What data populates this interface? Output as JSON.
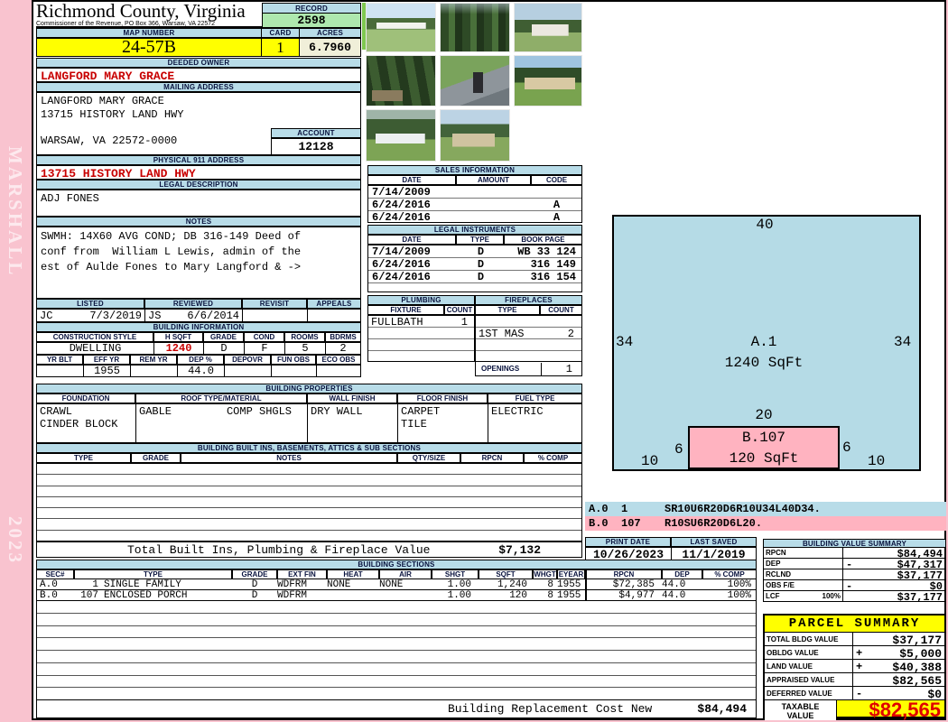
{
  "sidebar": {
    "vendor": "MARSHALL",
    "year": "2023"
  },
  "header": {
    "county": "Richmond County, Virginia",
    "commissioner": "Commissioner of the Revenue, PO Box 366, Warsaw, VA 22572",
    "record_label": "RECORD",
    "record_value": "2598",
    "map_label": "MAP NUMBER",
    "map_value": "24-57B",
    "card_label": "CARD",
    "card_value": "1",
    "acres_label": "ACRES",
    "acres_value": "6.7960"
  },
  "owner": {
    "deeded_label": "DEEDED OWNER",
    "deeded_value": "LANGFORD MARY GRACE",
    "mailing_label": "MAILING ADDRESS",
    "mail1": "LANGFORD MARY GRACE",
    "mail2": "13715 HISTORY LAND HWY",
    "mail3": "",
    "mail4": "WARSAW, VA 22572-0000",
    "account_label": "ACCOUNT",
    "account_value": "12128",
    "physical_label": "PHYSICAL 911 ADDRESS",
    "physical_value": "13715 HISTORY LAND HWY",
    "legal_label": "LEGAL DESCRIPTION",
    "legal_value": "ADJ FONES",
    "notes_label": "NOTES",
    "note1": "SWMH: 14X60 AVG COND; DB 316-149 Deed of",
    "note2": "conf from  William L Lewis, admin of the",
    "note3": "est of Aulde Fones to Mary Langford & ->"
  },
  "review": {
    "h": [
      "LISTED",
      "REVIEWED",
      "REVISIT",
      "APPEALS"
    ],
    "listed_by": "JC",
    "listed_date": "7/3/2019",
    "reviewed_by": "JS",
    "reviewed_date": "6/6/2014",
    "revisit": "",
    "appeals": ""
  },
  "building_info": {
    "banner": "BUILDING INFORMATION",
    "h1": [
      "CONSTRUCTION STYLE",
      "H SQFT",
      "GRADE",
      "COND",
      "ROOMS",
      "BDRMS"
    ],
    "style": "DWELLING",
    "hsqft": "1240",
    "grade": "D",
    "cond": "F",
    "rooms": "5",
    "bdrms": "2",
    "h2": [
      "YR BLT",
      "EFF YR",
      "REM YR",
      "DEP %",
      "DEPOVR",
      "FUN OBS",
      "ECO OBS"
    ],
    "yrblt": "",
    "effyr": "1955",
    "remyr": "",
    "dep": "44.0",
    "depovr": "",
    "funobs": "",
    "ecoobs": ""
  },
  "props": {
    "banner": "BUILDING PROPERTIES",
    "h": [
      "FOUNDATION",
      "ROOF TYPE/MATERIAL",
      "WALL FINISH",
      "FLOOR FINISH",
      "FUEL TYPE"
    ],
    "foundation1": "CRAWL",
    "foundation2": "CINDER BLOCK",
    "roof1": "GABLE",
    "roof2": "COMP SHGLS",
    "wall": "DRY WALL",
    "floor1": "CARPET",
    "floor2": "TILE",
    "fuel": "ELECTRIC"
  },
  "built_ins": {
    "banner": "BUILDING BUILT INS, BASEMENTS, ATTICS & SUB SECTIONS",
    "h": [
      "TYPE",
      "GRADE",
      "NOTES",
      "QTY/SIZE",
      "RPCN",
      "% COMP"
    ],
    "total_label": "Total Built Ins, Plumbing & Fireplace Value",
    "total_value": "$7,132"
  },
  "sales": {
    "banner": "SALES INFORMATION",
    "h": [
      "DATE",
      "AMOUNT",
      "CODE"
    ],
    "rows": [
      {
        "date": "7/14/2009",
        "amount": "",
        "code": ""
      },
      {
        "date": "6/24/2016",
        "amount": "",
        "code": "A"
      },
      {
        "date": "6/24/2016",
        "amount": "",
        "code": "A"
      }
    ]
  },
  "legal": {
    "banner": "LEGAL INSTRUMENTS",
    "h": [
      "DATE",
      "TYPE",
      "BOOK PAGE"
    ],
    "rows": [
      {
        "date": "7/14/2009",
        "type": "D",
        "book": "WB 33 124"
      },
      {
        "date": "6/24/2016",
        "type": "D",
        "book": "316 149"
      },
      {
        "date": "6/24/2016",
        "type": "D",
        "book": "316 154"
      }
    ]
  },
  "plumbing": {
    "banner": "PLUMBING",
    "h": [
      "FIXTURE",
      "COUNT"
    ],
    "fixture": "FULLBATH",
    "count": "1"
  },
  "fireplaces": {
    "banner": "FIREPLACES",
    "h": [
      "TYPE",
      "COUNT"
    ],
    "type": "1ST MAS",
    "count": "2",
    "openings_label": "OPENINGS",
    "openings": "1"
  },
  "sketch": {
    "a_top": "40",
    "a_left": "34",
    "a_right": "34",
    "a_code": "A.1",
    "a_sqft": "1240 SqFt",
    "b_top": "20",
    "b_left": "6",
    "b_right": "6",
    "b_bl": "10",
    "b_br": "10",
    "b_code": "B.107",
    "b_sqft": "120 SqFt",
    "legend": [
      {
        "sec": "A.0",
        "num": "1",
        "path": "SR10U6R20D6R10U34L40D34."
      },
      {
        "sec": "B.0",
        "num": "107",
        "path": "R10SU6R20D6L20."
      }
    ]
  },
  "print_info": {
    "print_label": "PRINT DATE",
    "print_value": "10/26/2023",
    "saved_label": "LAST SAVED",
    "saved_value": "11/1/2019"
  },
  "bvs": {
    "banner": "BUILDING VALUE SUMMARY",
    "rows": [
      {
        "label": "RPCN",
        "suffix": "",
        "sign": "",
        "value": "$84,494"
      },
      {
        "label": "DEP",
        "suffix": "",
        "sign": "-",
        "value": "$47,317"
      },
      {
        "label": "RCLND",
        "suffix": "",
        "sign": "",
        "value": "$37,177"
      },
      {
        "label": "OBS F/E",
        "suffix": "",
        "sign": "-",
        "value": "$0"
      },
      {
        "label": "LCF",
        "suffix": "100%",
        "sign": "",
        "value": "$37,177"
      }
    ]
  },
  "sections": {
    "banner": "BUILDING SECTIONS",
    "h": [
      "SEC#",
      "TYPE",
      "GRADE",
      "EXT FIN",
      "HEAT",
      "AIR",
      "SHGT",
      "SQFT",
      "WHGT",
      "EYEAR",
      "RPCN",
      "DEP",
      "% COMP"
    ],
    "rows": [
      {
        "sec": "A.0",
        "num": "1",
        "type": "SINGLE FAMILY",
        "grade": "D",
        "ext": "WDFRM",
        "heat": "NONE",
        "air": "NONE",
        "shgt": "1.00",
        "sqft": "1,240",
        "whgt": "8",
        "eyear": "1955",
        "rpcn": "$72,385",
        "dep": "44.0",
        "comp": "100%"
      },
      {
        "sec": "B.0",
        "num": "107",
        "type": "ENCLOSED PORCH",
        "grade": "D",
        "ext": "WDFRM",
        "heat": "",
        "air": "",
        "shgt": "1.00",
        "sqft": "120",
        "whgt": "8",
        "eyear": "1955",
        "rpcn": "$4,977",
        "dep": "44.0",
        "comp": "100%"
      }
    ],
    "replacement_label": "Building Replacement Cost New",
    "replacement_value": "$84,494"
  },
  "parcel": {
    "banner": "PARCEL SUMMARY",
    "rows": [
      {
        "label": "TOTAL BLDG VALUE",
        "sign": "",
        "value": "$37,177"
      },
      {
        "label": "OBLDG VALUE",
        "sign": "+",
        "value": "$5,000"
      },
      {
        "label": "LAND VALUE",
        "sign": "+",
        "value": "$40,388"
      },
      {
        "label": "APPRAISED VALUE",
        "sign": "",
        "value": "$82,565"
      },
      {
        "label": "DEFERRED VALUE",
        "sign": "-",
        "value": "$0"
      }
    ],
    "taxable1": "TAXABLE",
    "taxable2": "VALUE",
    "taxable_value": "$82,565"
  }
}
